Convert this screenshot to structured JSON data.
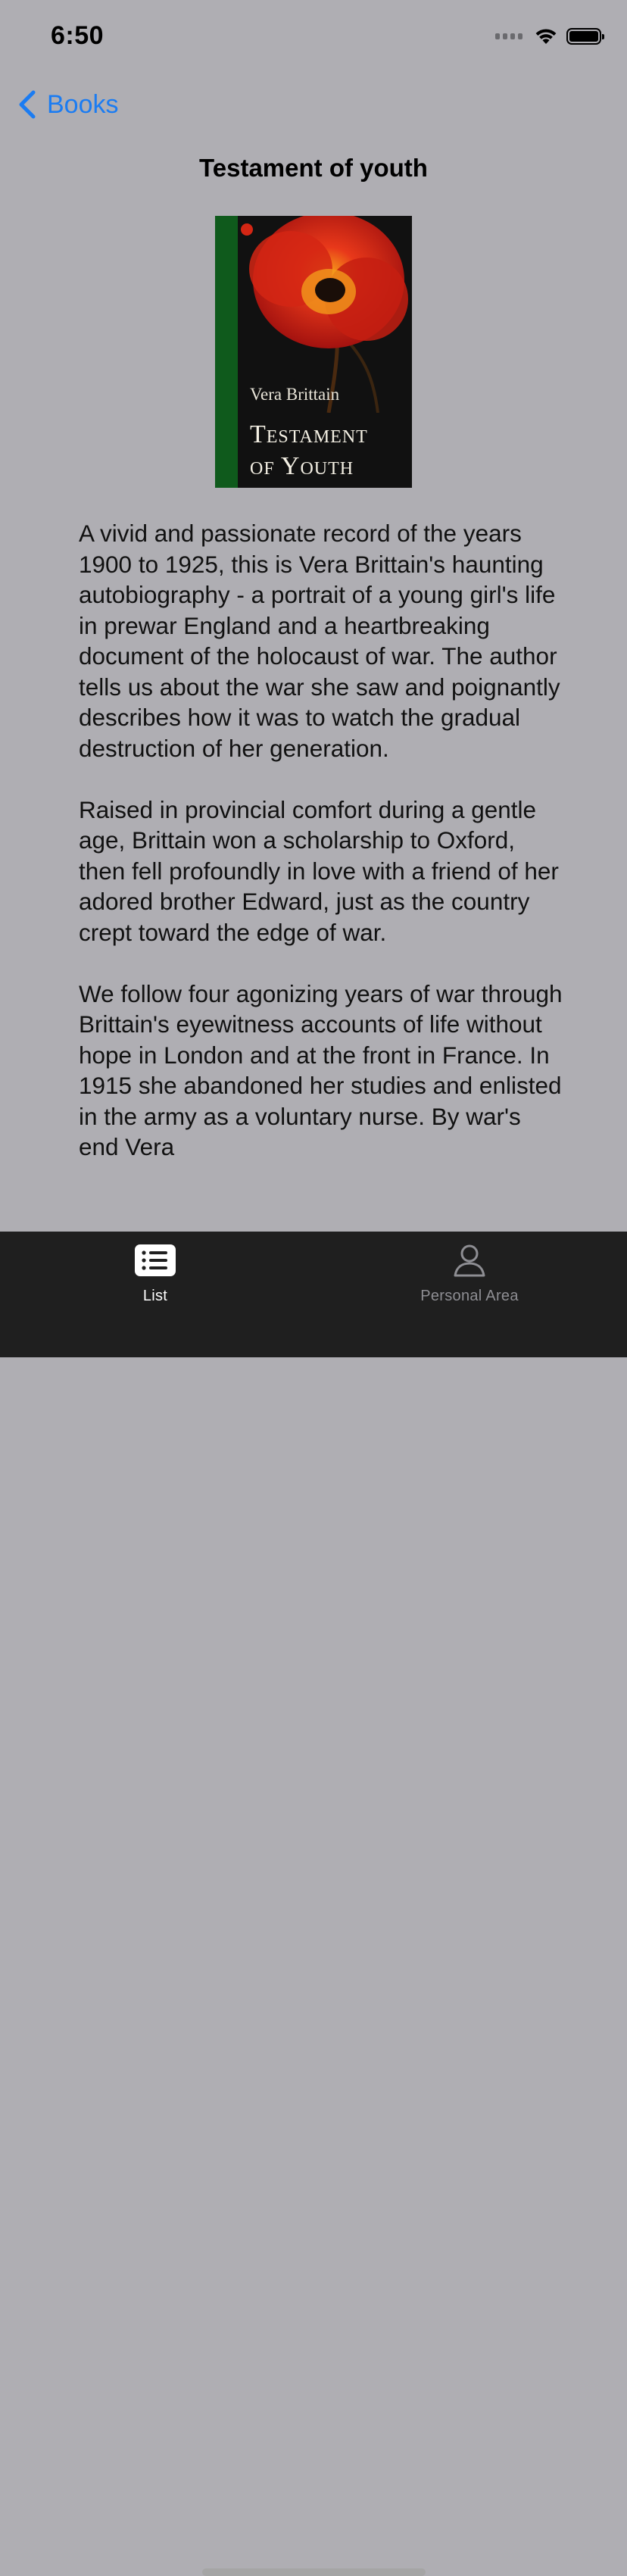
{
  "status_bar": {
    "time": "6:50"
  },
  "nav": {
    "back_label": "Books"
  },
  "book": {
    "title": "Testament of youth",
    "cover": {
      "author": "Vera Brittain",
      "title_line1": "Testament",
      "title_line2": "of Youth"
    },
    "description": [
      "A vivid and passionate record of the years 1900 to 1925, this is Vera Brittain's haunting autobiography - a portrait of a young girl's life in prewar England and a heartbreaking document of the holocaust of war. The author tells us about the war she saw and poignantly describes how it was to watch the gradual destruction of her generation.",
      "Raised in provincial comfort during a gentle age, Brittain won a scholarship to Oxford, then fell profoundly in love with a friend of her adored brother Edward, just as the country crept toward the edge of war.",
      "We follow four agonizing years of war through Brittain's eyewitness accounts of life without hope in London and at the front in France. In 1915 she abandoned her studies and enlisted in the army as a voluntary nurse. By war's end Vera"
    ]
  },
  "tab_bar": {
    "tabs": [
      {
        "label": "List",
        "icon": "list-icon",
        "selected": true
      },
      {
        "label": "Personal Area",
        "icon": "person-icon",
        "selected": false
      }
    ]
  },
  "colors": {
    "background": "#afaeb3",
    "accent": "#1b7cf2",
    "tab_bar": "#1f1f1f",
    "tab_inactive": "#8e8e93"
  }
}
